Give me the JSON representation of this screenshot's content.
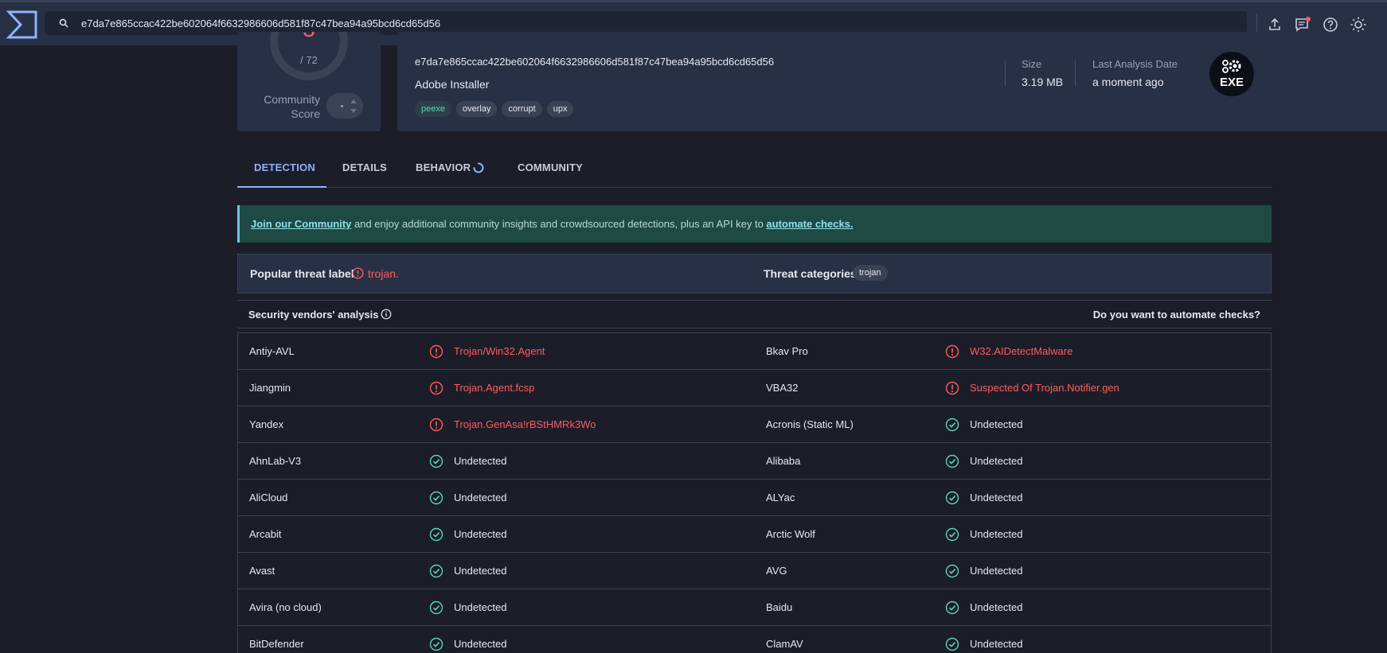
{
  "search": {
    "value": "e7da7e865ccac422be602064f6632986606d581f87c47bea94a95bcd6cd65d56"
  },
  "toolbar": {
    "icons": [
      "upload-icon",
      "notifications-icon",
      "help-icon",
      "theme-icon"
    ]
  },
  "score": {
    "max": "/ 72",
    "community_label_1": "Community",
    "community_label_2": "Score"
  },
  "file": {
    "hash": "e7da7e865ccac422be602064f6632986606d581f87c47bea94a95bcd6cd65d56",
    "name": "Adobe Installer",
    "tags": [
      "peexe",
      "overlay",
      "corrupt",
      "upx"
    ],
    "size_label": "Size",
    "size_value": "3.19 MB",
    "last_label": "Last Analysis Date",
    "last_value": "a moment ago",
    "type_badge": "EXE"
  },
  "tabs": [
    "DETECTION",
    "DETAILS",
    "BEHAVIOR",
    "COMMUNITY"
  ],
  "banner": {
    "link1": "Join our Community",
    "middle": " and enjoy additional community insights and crowdsourced detections, plus an API key to ",
    "link2": "automate checks."
  },
  "threat": {
    "label": "Popular threat label",
    "value": "trojan.",
    "categories_label": "Threat categories",
    "category": "trojan"
  },
  "vendors": {
    "title": "Security vendors' analysis",
    "automate": "Do you want to automate checks?",
    "rows": [
      [
        {
          "name": "Antiy-AVL",
          "result": "Trojan/Win32.Agent",
          "status": "malicious"
        },
        {
          "name": "Bkav Pro",
          "result": "W32.AIDetectMalware",
          "status": "malicious"
        }
      ],
      [
        {
          "name": "Jiangmin",
          "result": "Trojan.Agent.fcsp",
          "status": "malicious"
        },
        {
          "name": "VBA32",
          "result": "Suspected Of Trojan.Notifier.gen",
          "status": "malicious"
        }
      ],
      [
        {
          "name": "Yandex",
          "result": "Trojan.GenAsa!rBStHMRk3Wo",
          "status": "malicious"
        },
        {
          "name": "Acronis (Static ML)",
          "result": "Undetected",
          "status": "undetected"
        }
      ],
      [
        {
          "name": "AhnLab-V3",
          "result": "Undetected",
          "status": "undetected"
        },
        {
          "name": "Alibaba",
          "result": "Undetected",
          "status": "undetected"
        }
      ],
      [
        {
          "name": "AliCloud",
          "result": "Undetected",
          "status": "undetected"
        },
        {
          "name": "ALYac",
          "result": "Undetected",
          "status": "undetected"
        }
      ],
      [
        {
          "name": "Arcabit",
          "result": "Undetected",
          "status": "undetected"
        },
        {
          "name": "Arctic Wolf",
          "result": "Undetected",
          "status": "undetected"
        }
      ],
      [
        {
          "name": "Avast",
          "result": "Undetected",
          "status": "undetected"
        },
        {
          "name": "AVG",
          "result": "Undetected",
          "status": "undetected"
        }
      ],
      [
        {
          "name": "Avira (no cloud)",
          "result": "Undetected",
          "status": "undetected"
        },
        {
          "name": "Baidu",
          "result": "Undetected",
          "status": "undetected"
        }
      ],
      [
        {
          "name": "BitDefender",
          "result": "Undetected",
          "status": "undetected"
        },
        {
          "name": "ClamAV",
          "result": "Undetected",
          "status": "undetected"
        }
      ]
    ]
  },
  "colors": {
    "malicious": "#ff5c5c",
    "undetected_icon": "#5fd3b5",
    "accent": "#8fb2ff"
  }
}
